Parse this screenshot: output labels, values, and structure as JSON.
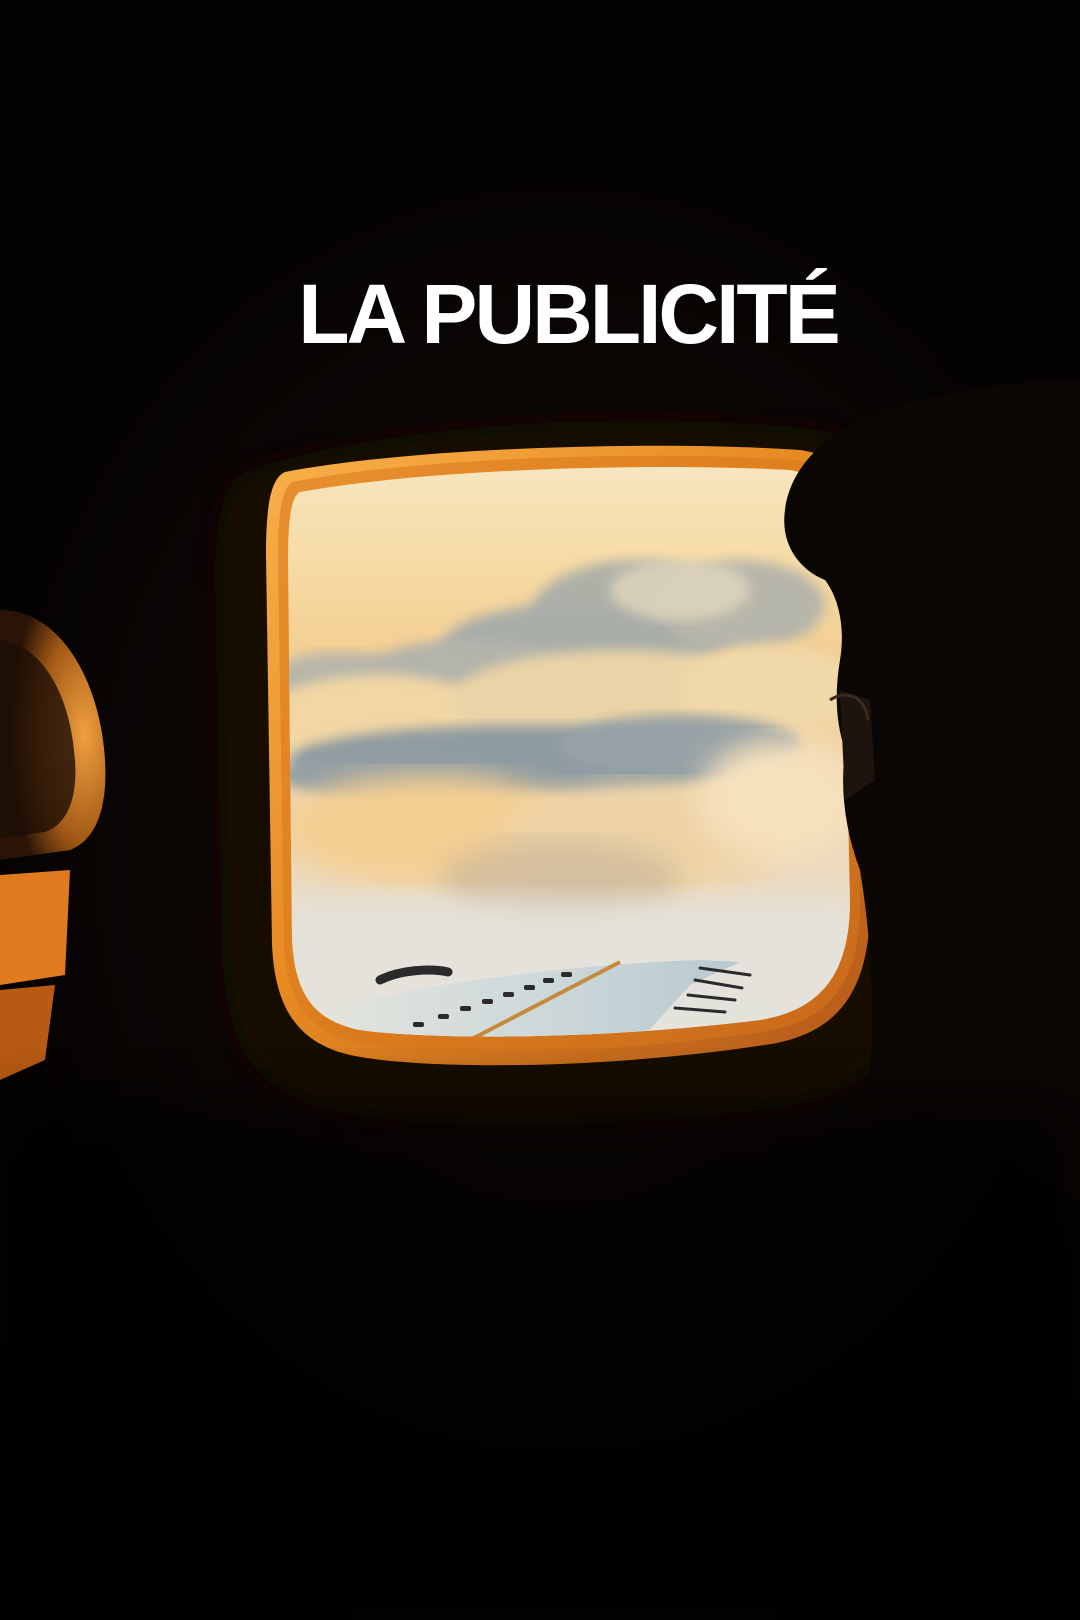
{
  "poster": {
    "title": "LA PUBLICITÉ"
  },
  "palette": {
    "background": "#050302",
    "window_frame_glow": "#f0a13a",
    "sky_top": "#f6e2b8",
    "cloud_highlight": "#f6d39c",
    "cloud_shadow": "#8f9aa3",
    "wing": "#cfd9dc",
    "title_text": "#ffffff"
  },
  "scene": {
    "subject": "airplane-window-view",
    "elements": [
      "window-frame-icon",
      "cloud-layer-icon",
      "wing-icon",
      "passenger-silhouette-icon",
      "seat-icon"
    ]
  }
}
